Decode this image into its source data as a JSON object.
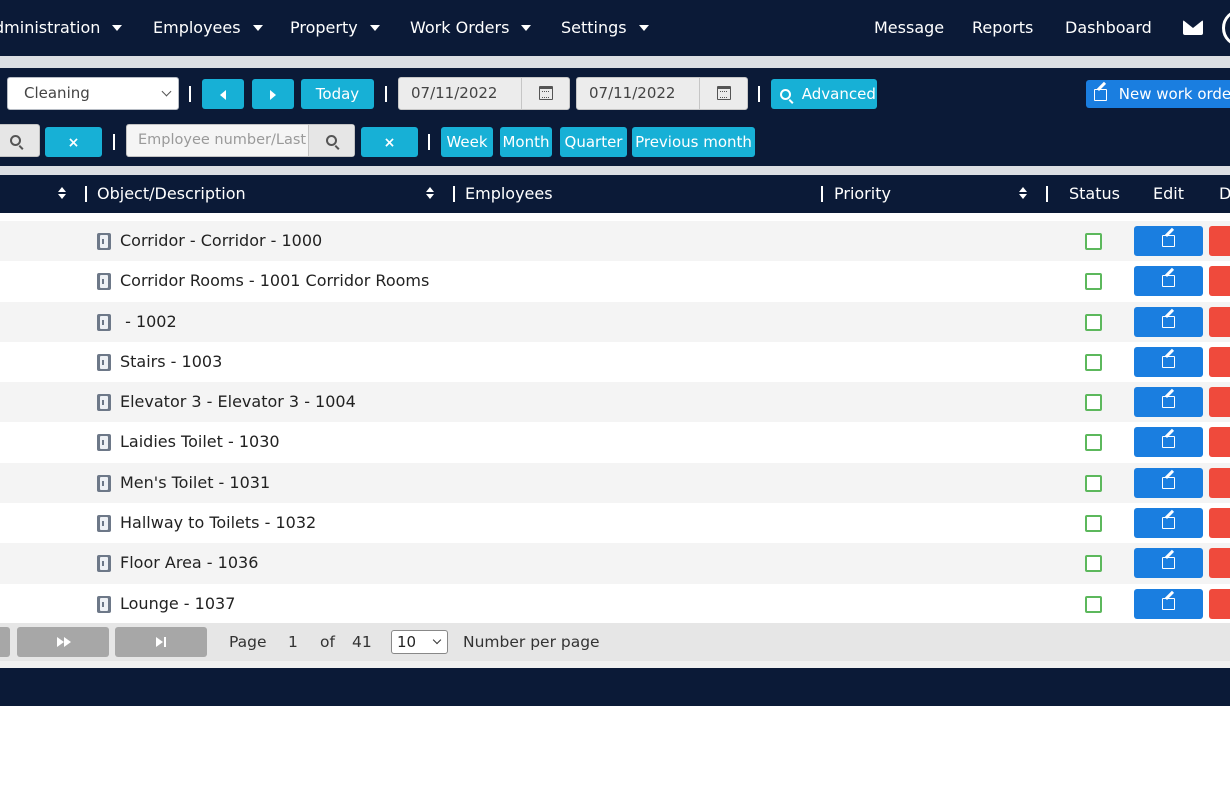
{
  "nav": {
    "left_items": [
      {
        "label": "dministration"
      },
      {
        "label": "Employees"
      },
      {
        "label": "Property"
      },
      {
        "label": "Work Orders"
      },
      {
        "label": "Settings"
      }
    ],
    "right_items": [
      {
        "label": "Message"
      },
      {
        "label": "Reports"
      },
      {
        "label": "Dashboard"
      }
    ]
  },
  "toolbar": {
    "type_select": {
      "value": "Cleaning"
    },
    "today_label": "Today",
    "date_from": "07/11/2022",
    "date_to": "07/11/2022",
    "advanced_label": "Advanced",
    "new_work_order_label": "New work order",
    "clear_label": "×",
    "employee_search_placeholder": "Employee number/Last",
    "period_buttons": [
      {
        "label": "Week"
      },
      {
        "label": "Month"
      },
      {
        "label": "Quarter"
      },
      {
        "label": "Previous month"
      }
    ]
  },
  "table": {
    "columns": {
      "object_description": "Object/Description",
      "employees": "Employees",
      "priority": "Priority",
      "status": "Status",
      "edit": "Edit",
      "delete": "D"
    },
    "rows": [
      {
        "description": "Corridor - Corridor - 1000"
      },
      {
        "description": "Corridor Rooms - 1001 Corridor Rooms"
      },
      {
        "description": " - 1002"
      },
      {
        "description": "Stairs - 1003"
      },
      {
        "description": "Elevator 3 - Elevator 3 - 1004"
      },
      {
        "description": "Laidies Toilet - 1030"
      },
      {
        "description": "Men's Toilet - 1031"
      },
      {
        "description": "Hallway to Toilets - 1032"
      },
      {
        "description": "Floor Area - 1036"
      },
      {
        "description": "Lounge - 1037"
      }
    ]
  },
  "pager": {
    "page_label": "Page",
    "current_page": "1",
    "of_label": "of",
    "total_pages": "41",
    "per_page": "10",
    "per_page_label": "Number per page"
  },
  "colors": {
    "navy": "#0b1a37",
    "teal": "#17b0d6",
    "blue": "#1a7ee0",
    "red": "#ef4a3c",
    "status_green": "#5cb85c"
  }
}
